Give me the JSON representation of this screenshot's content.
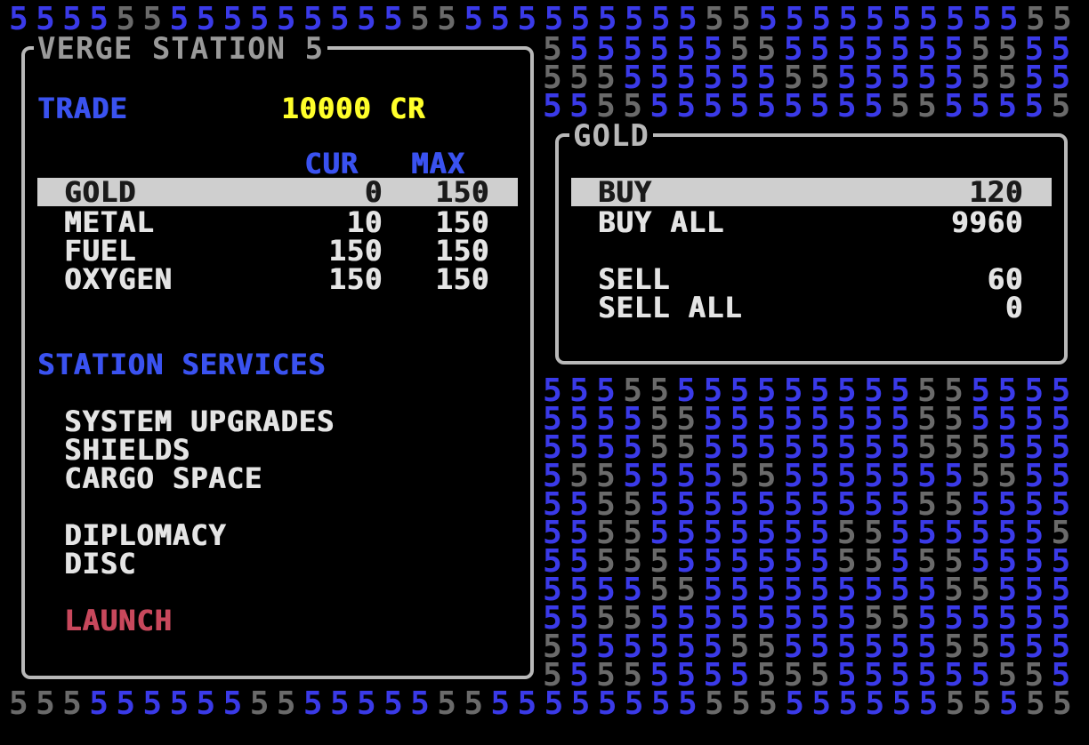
{
  "background": {
    "glyph": "5",
    "colors": {
      "blue": "#3a3ae8",
      "gray": "#6a6a6a"
    }
  },
  "station": {
    "title": "VERGE STATION 5"
  },
  "trade": {
    "label": "TRADE",
    "credits": "10000 CR",
    "col_cur": "CUR",
    "col_max": "MAX",
    "items": [
      {
        "name": "GOLD",
        "cur": "0",
        "max": "150",
        "selected": true
      },
      {
        "name": "METAL",
        "cur": "10",
        "max": "150",
        "selected": false
      },
      {
        "name": "FUEL",
        "cur": "150",
        "max": "150",
        "selected": false
      },
      {
        "name": "OXYGEN",
        "cur": "150",
        "max": "150",
        "selected": false
      }
    ]
  },
  "services": {
    "label": "STATION SERVICES",
    "items": [
      {
        "name": "SYSTEM UPGRADES"
      },
      {
        "name": "SHIELDS"
      },
      {
        "name": "CARGO SPACE"
      },
      {
        "name": "DIPLOMACY"
      },
      {
        "name": "DISC"
      }
    ],
    "launch": "LAUNCH"
  },
  "commodity_panel": {
    "title": "GOLD",
    "actions": [
      {
        "label": "BUY",
        "value": "120",
        "selected": true
      },
      {
        "label": "BUY ALL",
        "value": "9960",
        "selected": false
      },
      {
        "label": "SELL",
        "value": "60",
        "selected": false
      },
      {
        "label": "SELL ALL",
        "value": "0",
        "selected": false
      }
    ]
  },
  "colors": {
    "text_white": "#e4e4e4",
    "heading_blue": "#3a52f0",
    "credits_yellow": "#ffff2a",
    "launch_red": "#c8485c",
    "highlight": "#cfcfcf",
    "border": "#b8b8b8"
  }
}
